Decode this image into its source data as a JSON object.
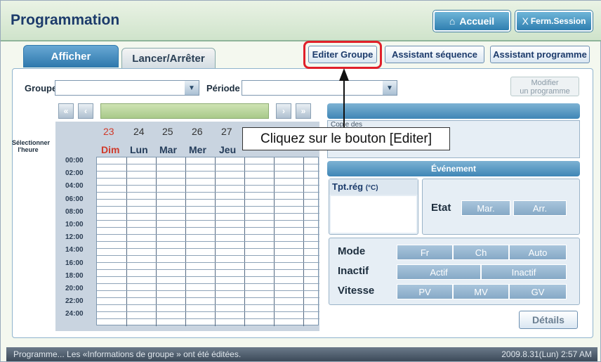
{
  "window": {
    "title": "Programmation"
  },
  "top_buttons": {
    "home": "Accueil",
    "close_session": "Ferm.Session",
    "close_mark": "X"
  },
  "tabs": [
    {
      "label": "Afficher"
    },
    {
      "label": "Lancer/Arrêter"
    }
  ],
  "header_buttons": {
    "edit_group": "Editer Groupe",
    "sequence_wizard": "Assistant séquence",
    "program_wizard": "Assistant programme"
  },
  "filters": {
    "group_label": "Groupe",
    "period_label": "Période",
    "modify_line1": "Modifier",
    "modify_line2": "un programme"
  },
  "schedule": {
    "select_time_line1": "Sélectionner",
    "select_time_line2": "l'heure",
    "days": [
      {
        "num": "23",
        "name": "Dim"
      },
      {
        "num": "24",
        "name": "Lun"
      },
      {
        "num": "25",
        "name": "Mar"
      },
      {
        "num": "26",
        "name": "Mer"
      },
      {
        "num": "27",
        "name": "Jeu"
      }
    ],
    "hours": [
      "00:00",
      "02:00",
      "04:00",
      "06:00",
      "08:00",
      "10:00",
      "12:00",
      "14:00",
      "16:00",
      "18:00",
      "20:00",
      "22:00",
      "24:00"
    ]
  },
  "right": {
    "partial_label": "Copie des",
    "event_label": "Événement",
    "setpoint_label": "Tpt.rég",
    "setpoint_unit": "(°C)",
    "state_label": "Etat",
    "state_on": "Mar.",
    "state_off": "Arr.",
    "mode_label": "Mode",
    "mode_options": [
      "Fr",
      "Ch",
      "Auto"
    ],
    "inactive_label": "Inactif",
    "inactive_options": [
      "Actif",
      "Inactif"
    ],
    "speed_label": "Vitesse",
    "speed_options": [
      "PV",
      "MV",
      "GV"
    ],
    "details": "Détails"
  },
  "callout": "Cliquez sur le bouton [Editer]",
  "status": {
    "message": "Programme... Les «Informations de groupe » ont été éditées.",
    "datetime": "2009.8.31(Lun)  2:57 AM"
  },
  "colors": {
    "highlight": "#e0202a",
    "sunday": "#d03a2a"
  }
}
